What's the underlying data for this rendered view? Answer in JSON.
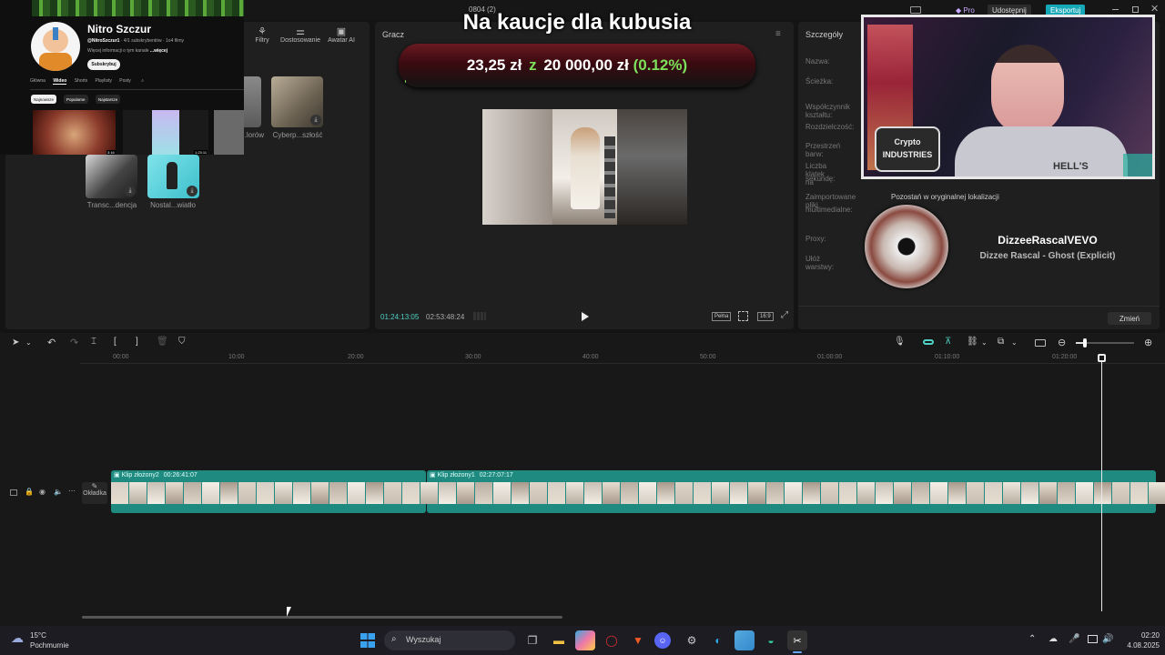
{
  "window": {
    "title": "0804 (2)",
    "pro_label": "Pro",
    "share_label": "Udostępnij",
    "export_label": "Eksportuj"
  },
  "overlay_title": "Na kaucje dla kubusia",
  "donation": {
    "current": "23,25 zł",
    "separator": "z",
    "goal": "20 000,00 zł",
    "percent": "(0.12%)",
    "progress": 0.0012
  },
  "channel": {
    "name": "Nitro Szczur",
    "handle": "@NitroSzczur1",
    "stats": "· 4/1 subskrybentów · 1o4 filmy",
    "desc": "Więcej informacji o tym kanale",
    "more": "...więcej",
    "subscribe": "Subskrybuj",
    "tabs": [
      "Główna",
      "Wideo",
      "Shorts",
      "Playlisty",
      "Posty"
    ],
    "filters": [
      "Najnowsze",
      "Popularne",
      "Najstarsze"
    ],
    "video_durations": [
      "3:16",
      "1:23:11"
    ]
  },
  "toolbar_top": {
    "filters": "Filtry",
    "adjust": "Dostosowanie",
    "avatar": "Awatar AI"
  },
  "media": {
    "items": [
      "...lorów",
      "Cyberp...szłość",
      "Transc...dencja",
      "Nostal...wiatło"
    ]
  },
  "player": {
    "title": "Gracz",
    "current_time": "01:24:13:05",
    "total_time": "02:53:48:24",
    "full_label": "Pełna",
    "ratio_label": "16:9"
  },
  "details": {
    "title": "Szczegóły",
    "rows": [
      "Nazwa:",
      "Ścieżka:",
      "Współczynnik kształtu:",
      "Rozdzielczość:",
      "Przestrzeń barw:",
      "Liczba klatek na",
      "sekundę:",
      "Zaimportowane pliki",
      "multimedialne:",
      "Proxy:",
      "Ułóż warstwy:"
    ],
    "import_value": "Pozostań w oryginalnej lokalizacji",
    "change_button": "Zmień"
  },
  "music": {
    "artist": "DizzeeRascalVEVO",
    "track": "Dizzee Rascal - Ghost (Explicit)"
  },
  "webcam": {
    "sign": "Crypto INDUSTRIES",
    "shirt": "HELL'S"
  },
  "timeline": {
    "ticks": [
      "00:00",
      "10:00",
      "20:00",
      "30:00",
      "40:00",
      "50:00",
      "01:00:00",
      "01:10:00",
      "01:20:00"
    ],
    "cover_label": "Okładka",
    "clips": [
      {
        "name": "Klip złożony2",
        "duration": "00:26:41:07"
      },
      {
        "name": "Klip złożony1",
        "duration": "02:27:07:17"
      }
    ]
  },
  "taskbar": {
    "temp": "15°C",
    "weather": "Pochmurnie",
    "search": "Wyszukaj",
    "time": "02:20",
    "date": "4.08.2025"
  },
  "colors": {
    "accent": "#4fd1c5",
    "clip": "#1f8a7f",
    "donation_green": "#7ce05a",
    "export_bg": "#17a8b8"
  }
}
